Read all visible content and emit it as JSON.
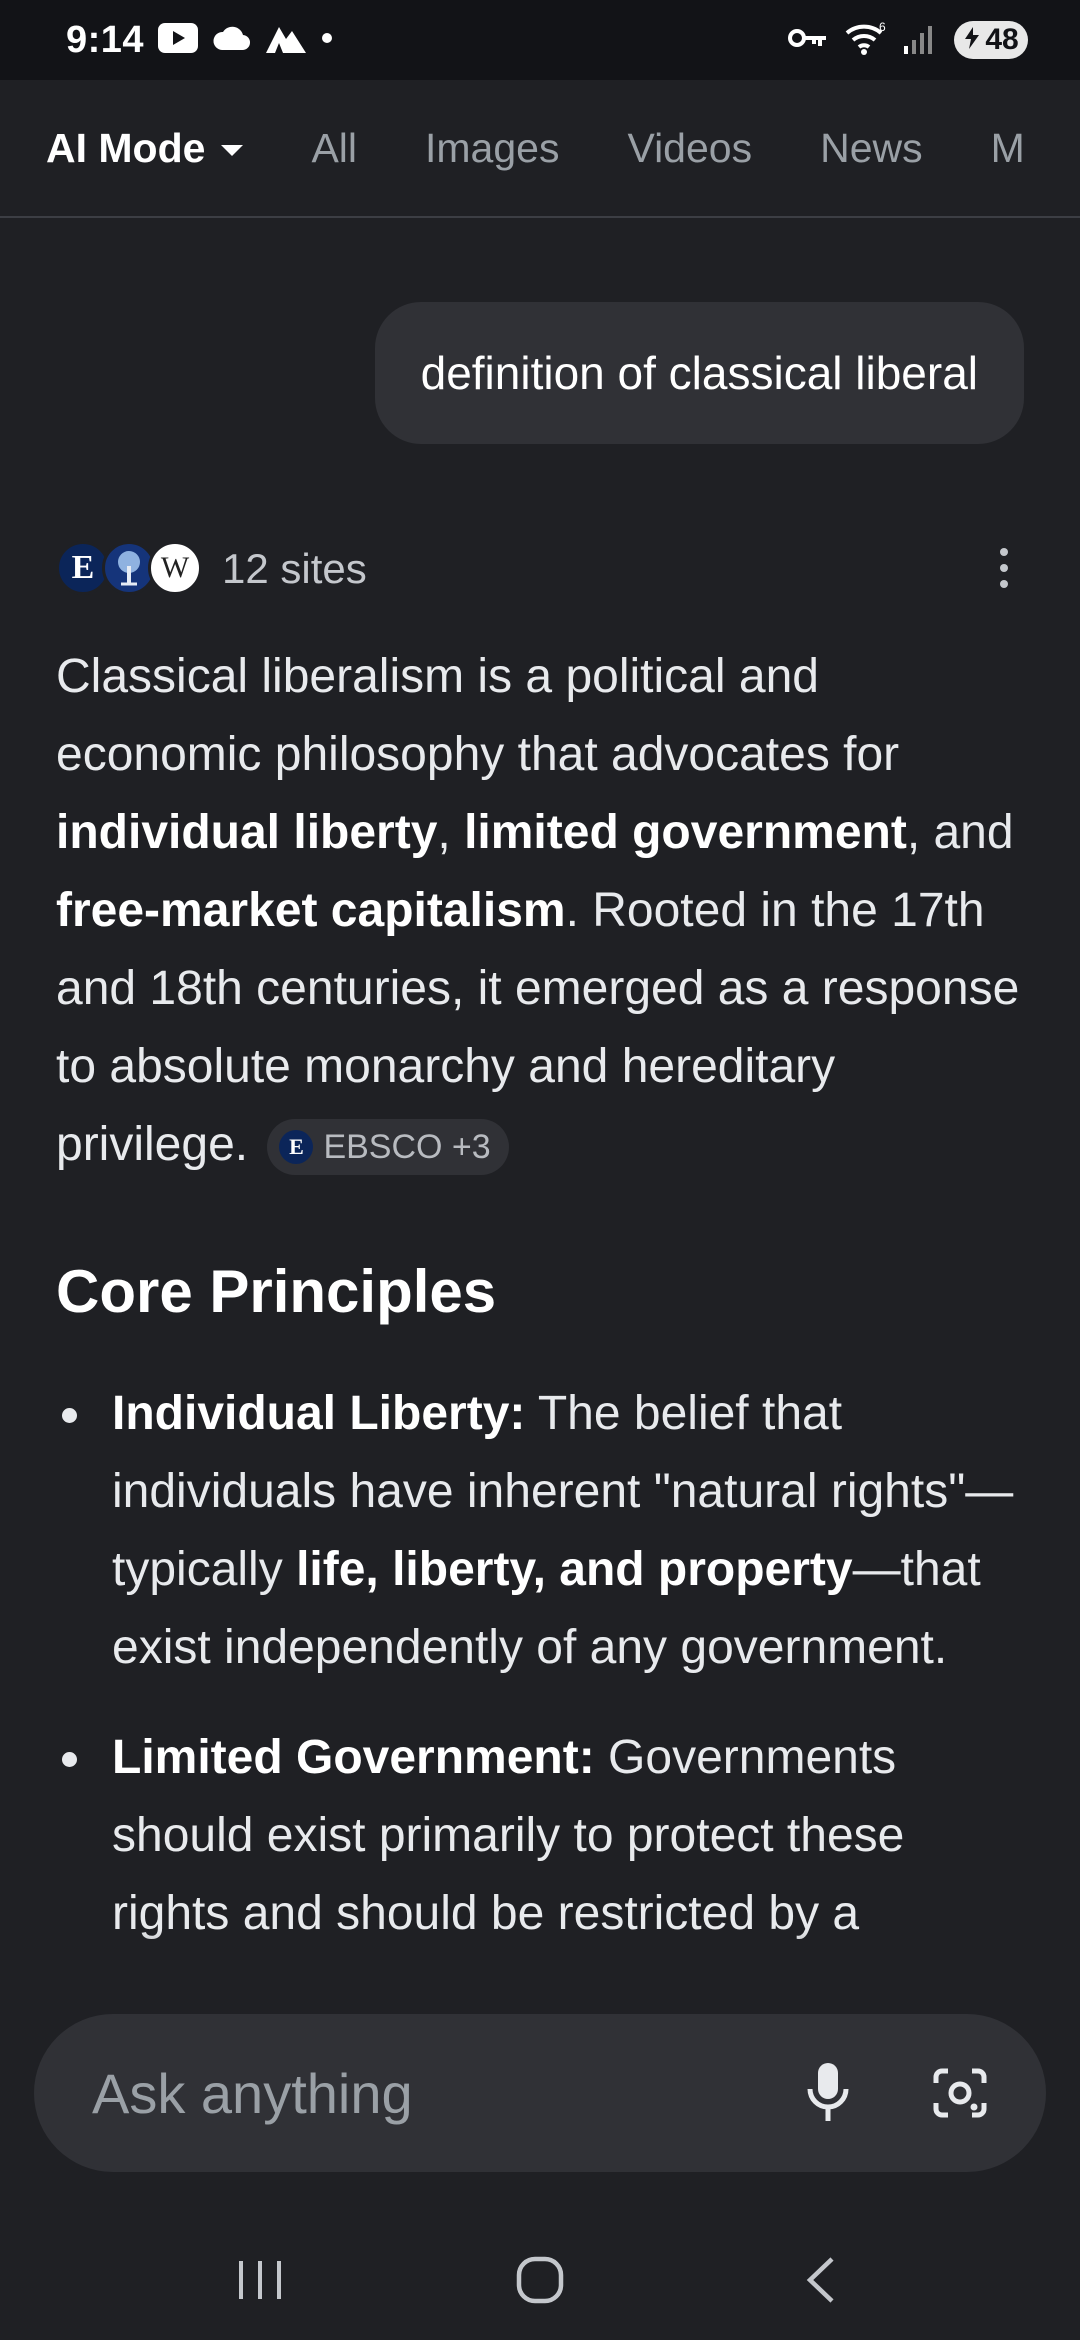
{
  "status_bar": {
    "time": "9:14",
    "battery": "48",
    "wifi_label": "6",
    "icons": [
      "youtube-icon",
      "cloud-icon",
      "mountain-icon",
      "dot-icon",
      "key-icon",
      "wifi-icon",
      "signal-icon",
      "battery-icon"
    ]
  },
  "tabs": [
    {
      "label": "AI Mode",
      "active": true
    },
    {
      "label": "All"
    },
    {
      "label": "Images"
    },
    {
      "label": "Videos"
    },
    {
      "label": "News"
    },
    {
      "label": "M"
    }
  ],
  "query": "definition of classical liberal",
  "sources": {
    "favicon_e": "E",
    "favicon_w": "W",
    "count_label": "12 sites"
  },
  "answer": {
    "p1": "Classical liberalism is a political and economic philosophy that advocates for ",
    "b1": "individual liberty",
    "p2": ", ",
    "b2": "limited government",
    "p3": ", and ",
    "b3": "free-market capitalism",
    "p4": ". Rooted in the 17th and 18th centuries, it emerged as a response to absolute monarchy and hereditary privilege. ",
    "citation": {
      "logo": "E",
      "label": "EBSCO +3"
    }
  },
  "section_heading": "Core Principles",
  "principles": [
    {
      "title": "Individual Liberty:",
      "t1": " The belief that individuals have inherent \"natural rights\"—typically ",
      "b1": "life, liberty, and property",
      "t2": "—that exist independently of any government."
    },
    {
      "title": "Limited Government:",
      "t1": " Governments should exist primarily to protect these rights and should be restricted by a"
    }
  ],
  "ask_bar": {
    "placeholder": "Ask anything"
  },
  "colors": {
    "background": "#1f2024",
    "status_bar": "#121317",
    "surface": "#303136",
    "text": "#e8eaed",
    "muted": "#9aa0a6"
  }
}
